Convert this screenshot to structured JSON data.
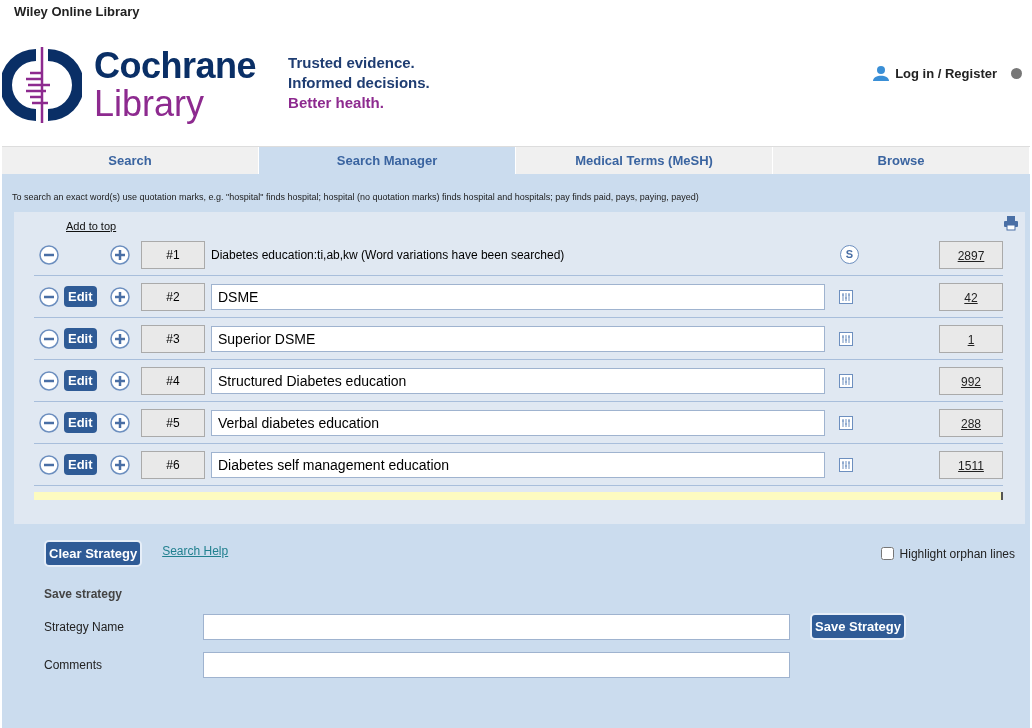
{
  "top_link": "Wiley Online Library",
  "brand": {
    "line_1": "Cochrane",
    "line_2": "Library"
  },
  "tagline": [
    "Trusted evidence.",
    "Informed decisions.",
    "Better health."
  ],
  "account": {
    "label": "Log in / Register"
  },
  "tabs": [
    {
      "label": "Search",
      "selected": false
    },
    {
      "label": "Search Manager",
      "selected": true
    },
    {
      "label": "Medical Terms (MeSH)",
      "selected": false
    },
    {
      "label": "Browse",
      "selected": false
    }
  ],
  "hint": "To search an exact word(s) use quotation marks, e.g. \"hospital\" finds hospital; hospital (no quotation marks) finds hospital and hospitals; pay finds paid, pays, paying, payed)",
  "add_to_top": "Add to top",
  "lines": [
    {
      "kind": "query",
      "number": "#1",
      "text": "Diabetes education:ti,ab,kw (Word variations have been searched)",
      "badge": "S",
      "count": "2897"
    },
    {
      "kind": "editable",
      "edit_label": "Edit",
      "number": "#2",
      "text": "DSME",
      "count": "42"
    },
    {
      "kind": "editable",
      "edit_label": "Edit",
      "number": "#3",
      "text": "Superior DSME",
      "count": "1"
    },
    {
      "kind": "editable",
      "edit_label": "Edit",
      "number": "#4",
      "text": "Structured Diabetes education",
      "count": "992"
    },
    {
      "kind": "editable",
      "edit_label": "Edit",
      "number": "#5",
      "text": "Verbal diabetes education",
      "count": "288"
    },
    {
      "kind": "editable",
      "edit_label": "Edit",
      "number": "#6",
      "text": "Diabetes self management education",
      "count": "1511"
    }
  ],
  "clear_button": "Clear Strategy",
  "help_link": "Search Help",
  "highlight_orphans": {
    "label": "Highlight orphan lines",
    "checked": false
  },
  "save": {
    "heading": "Save strategy",
    "name_label": "Strategy Name",
    "comments_label": "Comments",
    "button": "Save Strategy"
  }
}
